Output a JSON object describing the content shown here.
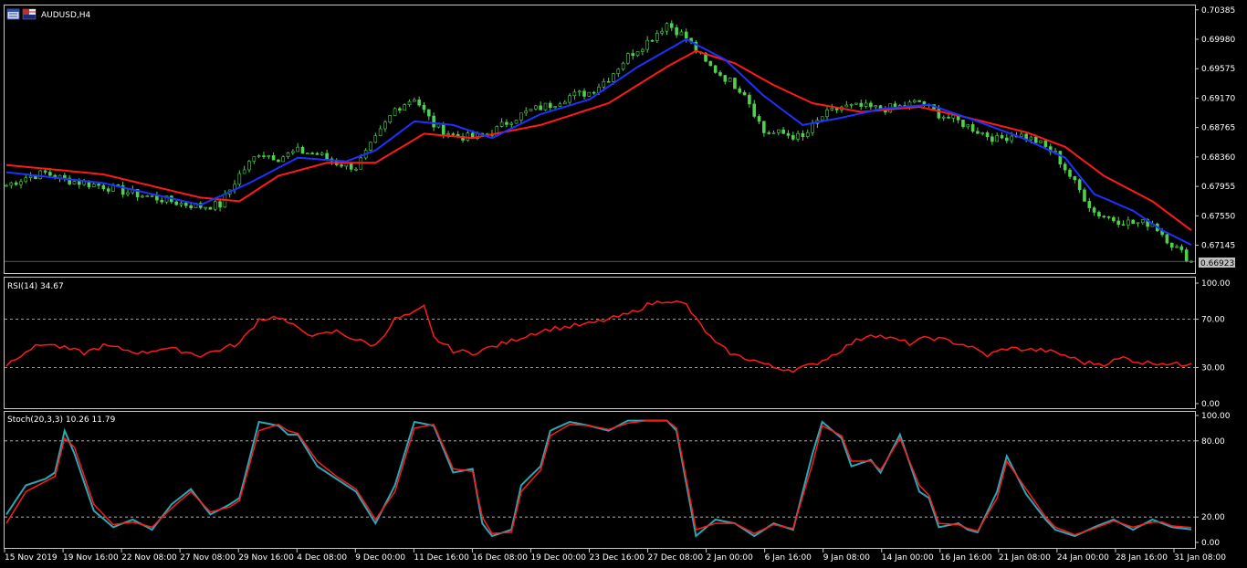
{
  "symbol": "AUDUSD,H4",
  "price_panel": {
    "current_price": "0.66923",
    "ticks": [
      "0.70385",
      "0.69980",
      "0.69575",
      "0.69170",
      "0.68765",
      "0.68360",
      "0.67955",
      "0.67550",
      "0.67145"
    ],
    "ylim": [
      0.668,
      0.7042
    ]
  },
  "rsi_panel": {
    "label": "RSI(14) 34.67",
    "ticks": [
      "100.00",
      "70.00",
      "30.00",
      "0.00"
    ],
    "levels": [
      70,
      30
    ]
  },
  "stoch_panel": {
    "label": "Stoch(20,3,3) 10.26  11.79",
    "ticks": [
      "100.00",
      "80.00",
      "20.00",
      "0.00"
    ],
    "levels": [
      80,
      20
    ]
  },
  "time_axis": [
    "15 Nov 2019",
    "19 Nov 16:00",
    "22 Nov 08:00",
    "27 Nov 08:00",
    "29 Nov 16:00",
    "4 Dec 08:00",
    "9 Dec 00:00",
    "11 Dec 16:00",
    "16 Dec 08:00",
    "19 Dec 00:00",
    "23 Dec 16:00",
    "27 Dec 08:00",
    "2 Jan 00:00",
    "6 Jan 16:00",
    "9 Jan 08:00",
    "14 Jan 00:00",
    "16 Jan 16:00",
    "21 Jan 08:00",
    "24 Jan 00:00",
    "28 Jan 16:00",
    "31 Jan 08:00"
  ],
  "colors": {
    "candle": "#4fd04f",
    "ma_fast": "#1e32ff",
    "ma_slow": "#ff1a1a",
    "rsi": "#ff1a1a",
    "stoch_main": "#2aa8b4",
    "stoch_signal": "#ff1a1a",
    "grid": "#c8c8c8",
    "frame": "#c8c8c8"
  },
  "chart_data": [
    {
      "type": "line",
      "name": "AUDUSD,H4 price",
      "x_ticks": [
        "15 Nov 2019",
        "19 Nov 16:00",
        "22 Nov 08:00",
        "27 Nov 08:00",
        "29 Nov 16:00",
        "4 Dec 08:00",
        "9 Dec 00:00",
        "11 Dec 16:00",
        "16 Dec 08:00",
        "19 Dec 00:00",
        "23 Dec 16:00",
        "27 Dec 08:00",
        "2 Jan 00:00",
        "6 Jan 16:00",
        "9 Jan 08:00",
        "14 Jan 00:00",
        "16 Jan 16:00",
        "21 Jan 08:00",
        "24 Jan 00:00",
        "28 Jan 16:00",
        "31 Jan 08:00"
      ],
      "close_keypoints": [
        [
          0,
          0.6797
        ],
        [
          4,
          0.6808
        ],
        [
          8,
          0.6814
        ],
        [
          12,
          0.6805
        ],
        [
          16,
          0.68
        ],
        [
          20,
          0.6796
        ],
        [
          24,
          0.6789
        ],
        [
          28,
          0.6783
        ],
        [
          32,
          0.6778
        ],
        [
          36,
          0.6772
        ],
        [
          40,
          0.6768
        ],
        [
          44,
          0.677
        ],
        [
          48,
          0.6812
        ],
        [
          52,
          0.6842
        ],
        [
          56,
          0.6835
        ],
        [
          60,
          0.6844
        ],
        [
          64,
          0.684
        ],
        [
          68,
          0.6828
        ],
        [
          72,
          0.6822
        ],
        [
          76,
          0.686
        ],
        [
          80,
          0.6902
        ],
        [
          84,
          0.6918
        ],
        [
          88,
          0.688
        ],
        [
          92,
          0.6866
        ],
        [
          96,
          0.6862
        ],
        [
          100,
          0.687
        ],
        [
          104,
          0.6888
        ],
        [
          108,
          0.69
        ],
        [
          112,
          0.6908
        ],
        [
          116,
          0.692
        ],
        [
          120,
          0.6925
        ],
        [
          124,
          0.6945
        ],
        [
          128,
          0.6975
        ],
        [
          132,
          0.6995
        ],
        [
          136,
          0.702
        ],
        [
          140,
          0.7
        ],
        [
          144,
          0.6965
        ],
        [
          148,
          0.6945
        ],
        [
          152,
          0.6925
        ],
        [
          156,
          0.687
        ],
        [
          160,
          0.6868
        ],
        [
          164,
          0.6862
        ],
        [
          168,
          0.6892
        ],
        [
          172,
          0.6905
        ],
        [
          176,
          0.6905
        ],
        [
          180,
          0.6902
        ],
        [
          184,
          0.6905
        ],
        [
          188,
          0.6912
        ],
        [
          192,
          0.6895
        ],
        [
          196,
          0.6885
        ],
        [
          200,
          0.6872
        ],
        [
          204,
          0.686
        ],
        [
          208,
          0.6868
        ],
        [
          212,
          0.6858
        ],
        [
          216,
          0.684
        ],
        [
          220,
          0.68
        ],
        [
          224,
          0.676
        ],
        [
          228,
          0.675
        ],
        [
          232,
          0.6745
        ],
        [
          236,
          0.6745
        ],
        [
          240,
          0.6716
        ],
        [
          244,
          0.6692
        ]
      ],
      "ma_fast_keypoints": [
        [
          0,
          0.6815
        ],
        [
          20,
          0.68
        ],
        [
          40,
          0.677
        ],
        [
          50,
          0.68
        ],
        [
          60,
          0.6835
        ],
        [
          70,
          0.683
        ],
        [
          76,
          0.6845
        ],
        [
          84,
          0.6885
        ],
        [
          92,
          0.688
        ],
        [
          100,
          0.6862
        ],
        [
          110,
          0.6895
        ],
        [
          120,
          0.6915
        ],
        [
          130,
          0.696
        ],
        [
          140,
          0.6998
        ],
        [
          148,
          0.697
        ],
        [
          156,
          0.692
        ],
        [
          164,
          0.688
        ],
        [
          172,
          0.689
        ],
        [
          180,
          0.6902
        ],
        [
          190,
          0.6908
        ],
        [
          200,
          0.6885
        ],
        [
          210,
          0.686
        ],
        [
          218,
          0.6835
        ],
        [
          224,
          0.6785
        ],
        [
          232,
          0.6762
        ],
        [
          238,
          0.6735
        ],
        [
          244,
          0.6715
        ]
      ],
      "ma_slow_keypoints": [
        [
          0,
          0.6825
        ],
        [
          20,
          0.6812
        ],
        [
          40,
          0.678
        ],
        [
          48,
          0.6775
        ],
        [
          56,
          0.681
        ],
        [
          66,
          0.6828
        ],
        [
          76,
          0.6828
        ],
        [
          86,
          0.6868
        ],
        [
          96,
          0.6862
        ],
        [
          110,
          0.688
        ],
        [
          124,
          0.691
        ],
        [
          136,
          0.696
        ],
        [
          142,
          0.6982
        ],
        [
          150,
          0.6965
        ],
        [
          158,
          0.6935
        ],
        [
          166,
          0.691
        ],
        [
          176,
          0.6898
        ],
        [
          188,
          0.6905
        ],
        [
          198,
          0.689
        ],
        [
          210,
          0.687
        ],
        [
          218,
          0.685
        ],
        [
          226,
          0.681
        ],
        [
          236,
          0.6775
        ],
        [
          244,
          0.6735
        ]
      ],
      "ylim": [
        0.668,
        0.7042
      ]
    },
    {
      "type": "line",
      "name": "RSI(14)",
      "keypoints": [
        [
          0,
          32
        ],
        [
          4,
          44
        ],
        [
          8,
          50
        ],
        [
          12,
          46
        ],
        [
          16,
          42
        ],
        [
          20,
          48
        ],
        [
          24,
          45
        ],
        [
          28,
          42
        ],
        [
          32,
          46
        ],
        [
          36,
          44
        ],
        [
          40,
          40
        ],
        [
          44,
          45
        ],
        [
          48,
          50
        ],
        [
          52,
          70
        ],
        [
          56,
          72
        ],
        [
          60,
          62
        ],
        [
          64,
          56
        ],
        [
          68,
          60
        ],
        [
          72,
          53
        ],
        [
          76,
          48
        ],
        [
          80,
          70
        ],
        [
          84,
          75
        ],
        [
          86,
          80
        ],
        [
          88,
          55
        ],
        [
          92,
          44
        ],
        [
          96,
          42
        ],
        [
          100,
          47
        ],
        [
          104,
          52
        ],
        [
          108,
          58
        ],
        [
          112,
          62
        ],
        [
          116,
          64
        ],
        [
          120,
          66
        ],
        [
          124,
          70
        ],
        [
          128,
          74
        ],
        [
          132,
          82
        ],
        [
          136,
          86
        ],
        [
          140,
          82
        ],
        [
          142,
          70
        ],
        [
          146,
          50
        ],
        [
          150,
          40
        ],
        [
          154,
          36
        ],
        [
          158,
          30
        ],
        [
          162,
          28
        ],
        [
          166,
          32
        ],
        [
          170,
          40
        ],
        [
          174,
          50
        ],
        [
          178,
          58
        ],
        [
          182,
          54
        ],
        [
          186,
          50
        ],
        [
          190,
          55
        ],
        [
          194,
          52
        ],
        [
          198,
          48
        ],
        [
          202,
          40
        ],
        [
          206,
          46
        ],
        [
          210,
          45
        ],
        [
          214,
          44
        ],
        [
          218,
          40
        ],
        [
          222,
          34
        ],
        [
          226,
          33
        ],
        [
          230,
          38
        ],
        [
          234,
          34
        ],
        [
          238,
          34
        ],
        [
          242,
          32
        ],
        [
          244,
          34.67
        ]
      ],
      "ylim": [
        0,
        100
      ]
    },
    {
      "type": "line",
      "name": "Stoch(20,3,3)",
      "main_keypoints": [
        [
          0,
          22
        ],
        [
          4,
          45
        ],
        [
          8,
          50
        ],
        [
          10,
          55
        ],
        [
          12,
          88
        ],
        [
          14,
          70
        ],
        [
          18,
          25
        ],
        [
          22,
          12
        ],
        [
          26,
          18
        ],
        [
          30,
          10
        ],
        [
          34,
          30
        ],
        [
          38,
          42
        ],
        [
          42,
          22
        ],
        [
          46,
          30
        ],
        [
          48,
          35
        ],
        [
          52,
          95
        ],
        [
          56,
          92
        ],
        [
          58,
          85
        ],
        [
          60,
          85
        ],
        [
          64,
          60
        ],
        [
          68,
          50
        ],
        [
          72,
          40
        ],
        [
          76,
          15
        ],
        [
          80,
          45
        ],
        [
          84,
          95
        ],
        [
          88,
          92
        ],
        [
          92,
          55
        ],
        [
          96,
          58
        ],
        [
          98,
          15
        ],
        [
          100,
          5
        ],
        [
          104,
          10
        ],
        [
          106,
          45
        ],
        [
          110,
          60
        ],
        [
          112,
          88
        ],
        [
          116,
          95
        ],
        [
          120,
          92
        ],
        [
          124,
          88
        ],
        [
          128,
          96
        ],
        [
          132,
          96
        ],
        [
          136,
          96
        ],
        [
          138,
          88
        ],
        [
          142,
          5
        ],
        [
          146,
          18
        ],
        [
          150,
          15
        ],
        [
          154,
          5
        ],
        [
          158,
          15
        ],
        [
          162,
          10
        ],
        [
          166,
          70
        ],
        [
          168,
          95
        ],
        [
          172,
          82
        ],
        [
          174,
          60
        ],
        [
          178,
          65
        ],
        [
          180,
          55
        ],
        [
          184,
          85
        ],
        [
          188,
          40
        ],
        [
          190,
          35
        ],
        [
          192,
          12
        ],
        [
          196,
          15
        ],
        [
          198,
          10
        ],
        [
          200,
          8
        ],
        [
          204,
          40
        ],
        [
          206,
          68
        ],
        [
          210,
          38
        ],
        [
          214,
          18
        ],
        [
          216,
          10
        ],
        [
          220,
          5
        ],
        [
          224,
          12
        ],
        [
          228,
          18
        ],
        [
          232,
          10
        ],
        [
          236,
          18
        ],
        [
          238,
          15
        ],
        [
          240,
          12
        ],
        [
          244,
          10.26
        ]
      ],
      "signal_keypoints": [
        [
          0,
          15
        ],
        [
          4,
          40
        ],
        [
          8,
          48
        ],
        [
          10,
          52
        ],
        [
          12,
          82
        ],
        [
          14,
          75
        ],
        [
          18,
          30
        ],
        [
          22,
          14
        ],
        [
          26,
          16
        ],
        [
          30,
          12
        ],
        [
          34,
          27
        ],
        [
          38,
          40
        ],
        [
          42,
          24
        ],
        [
          46,
          28
        ],
        [
          48,
          33
        ],
        [
          52,
          88
        ],
        [
          56,
          93
        ],
        [
          58,
          88
        ],
        [
          60,
          86
        ],
        [
          64,
          64
        ],
        [
          68,
          52
        ],
        [
          72,
          42
        ],
        [
          76,
          18
        ],
        [
          80,
          40
        ],
        [
          84,
          90
        ],
        [
          88,
          93
        ],
        [
          92,
          58
        ],
        [
          96,
          56
        ],
        [
          98,
          20
        ],
        [
          100,
          7
        ],
        [
          104,
          8
        ],
        [
          106,
          40
        ],
        [
          110,
          57
        ],
        [
          112,
          84
        ],
        [
          116,
          93
        ],
        [
          120,
          92
        ],
        [
          124,
          89
        ],
        [
          128,
          94
        ],
        [
          132,
          96
        ],
        [
          136,
          96
        ],
        [
          138,
          90
        ],
        [
          142,
          10
        ],
        [
          146,
          15
        ],
        [
          150,
          15
        ],
        [
          154,
          7
        ],
        [
          158,
          14
        ],
        [
          162,
          11
        ],
        [
          166,
          62
        ],
        [
          168,
          92
        ],
        [
          172,
          84
        ],
        [
          174,
          64
        ],
        [
          178,
          64
        ],
        [
          180,
          57
        ],
        [
          184,
          82
        ],
        [
          188,
          45
        ],
        [
          190,
          37
        ],
        [
          192,
          15
        ],
        [
          196,
          14
        ],
        [
          198,
          11
        ],
        [
          200,
          9
        ],
        [
          204,
          35
        ],
        [
          206,
          64
        ],
        [
          210,
          42
        ],
        [
          214,
          20
        ],
        [
          216,
          12
        ],
        [
          220,
          6
        ],
        [
          224,
          11
        ],
        [
          228,
          17
        ],
        [
          232,
          12
        ],
        [
          236,
          16
        ],
        [
          238,
          16
        ],
        [
          240,
          13
        ],
        [
          244,
          11.79
        ]
      ],
      "ylim": [
        0,
        100
      ]
    }
  ]
}
